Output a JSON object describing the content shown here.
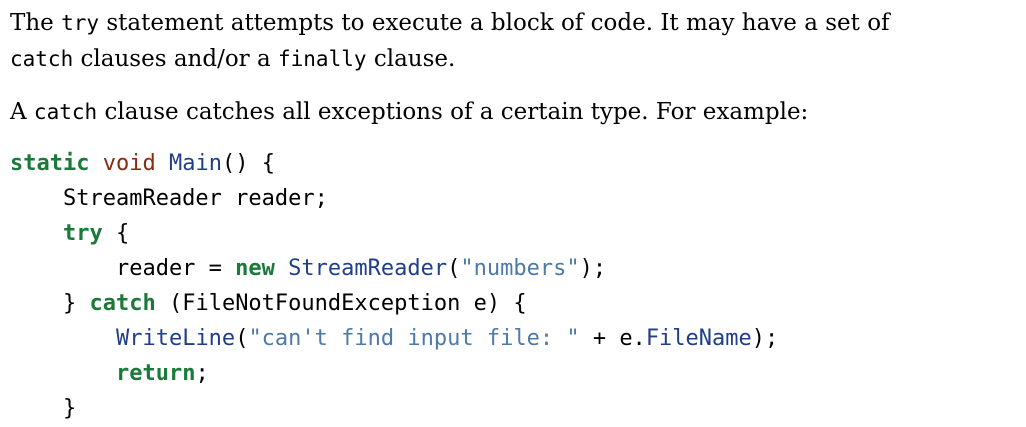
{
  "paragraphs": [
    {
      "lines": [
        [
          {
            "text": "The ",
            "kind": "text"
          },
          {
            "text": "try",
            "kind": "code"
          },
          {
            "text": " statement attempts to execute a block of code. It may have a set of",
            "kind": "text"
          }
        ],
        [
          {
            "text": "catch",
            "kind": "code"
          },
          {
            "text": " clauses and/or a ",
            "kind": "text"
          },
          {
            "text": "finally",
            "kind": "code"
          },
          {
            "text": " clause.",
            "kind": "text"
          }
        ]
      ]
    },
    {
      "lines": [
        [
          {
            "text": "A ",
            "kind": "text"
          },
          {
            "text": "catch",
            "kind": "code"
          },
          {
            "text": " clause catches all exceptions of a certain type. For example:",
            "kind": "text"
          }
        ]
      ]
    }
  ],
  "code": {
    "lines": [
      [
        {
          "t": "static",
          "c": "kw"
        },
        {
          "t": " ",
          "c": ""
        },
        {
          "t": "void",
          "c": "ty"
        },
        {
          "t": " ",
          "c": ""
        },
        {
          "t": "Main",
          "c": "fn"
        },
        {
          "t": "() {",
          "c": ""
        }
      ],
      [
        {
          "t": "    StreamReader reader;",
          "c": ""
        }
      ],
      [
        {
          "t": "    ",
          "c": ""
        },
        {
          "t": "try",
          "c": "kw"
        },
        {
          "t": " {",
          "c": ""
        }
      ],
      [
        {
          "t": "        reader = ",
          "c": ""
        },
        {
          "t": "new",
          "c": "kw"
        },
        {
          "t": " ",
          "c": ""
        },
        {
          "t": "StreamReader",
          "c": "fn"
        },
        {
          "t": "(",
          "c": ""
        },
        {
          "t": "\"numbers\"",
          "c": "str"
        },
        {
          "t": ");",
          "c": ""
        }
      ],
      [
        {
          "t": "    } ",
          "c": ""
        },
        {
          "t": "catch",
          "c": "kw"
        },
        {
          "t": " (FileNotFoundException e) {",
          "c": ""
        }
      ],
      [
        {
          "t": "        ",
          "c": ""
        },
        {
          "t": "WriteLine",
          "c": "fn"
        },
        {
          "t": "(",
          "c": ""
        },
        {
          "t": "\"can't find input file: \"",
          "c": "str"
        },
        {
          "t": " + e.",
          "c": ""
        },
        {
          "t": "FileName",
          "c": "fn"
        },
        {
          "t": ");",
          "c": ""
        }
      ],
      [
        {
          "t": "        ",
          "c": ""
        },
        {
          "t": "return",
          "c": "kw"
        },
        {
          "t": ";",
          "c": ""
        }
      ],
      [
        {
          "t": "    }",
          "c": ""
        }
      ]
    ]
  },
  "colors": {
    "keyword": "#1a7a3a",
    "type": "#8a2a0e",
    "function": "#1f3f8a",
    "string": "#4d7aa8"
  }
}
